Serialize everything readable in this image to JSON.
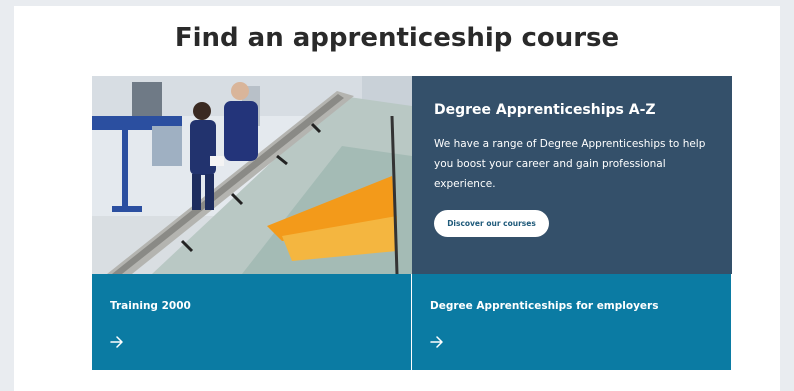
{
  "heading": "Find an apprenticeship course",
  "featured": {
    "title": "Degree Apprenticeships A-Z",
    "description": "We have a range of Degree Apprenticeships to help you boost your career and gain professional experience.",
    "button_label": "Discover our courses"
  },
  "cards": [
    {
      "title": "Training 2000",
      "icon": "arrow-right-icon"
    },
    {
      "title": "Degree Apprenticeships for employers",
      "icon": "arrow-right-icon"
    }
  ],
  "colors": {
    "featured_bg": "#34506a",
    "card_bg": "#0b7ba3",
    "heading": "#2a2a2a",
    "button_text": "#1f5a7a"
  }
}
